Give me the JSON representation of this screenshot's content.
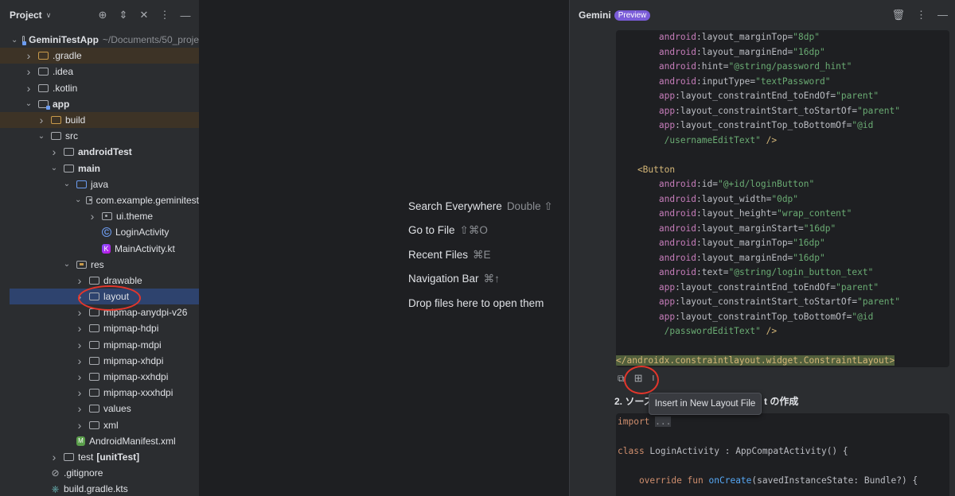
{
  "project_panel": {
    "title": "Project",
    "tree": [
      {
        "label": "GeminiTestApp",
        "suffix": "~/Documents/50_proje",
        "bold": true,
        "depth": 0,
        "arrow": "v",
        "icon": "module"
      },
      {
        "label": ".gradle",
        "depth": 1,
        "arrow": ">",
        "icon": "folder-orange",
        "highlight": "orange"
      },
      {
        "label": ".idea",
        "depth": 1,
        "arrow": ">",
        "icon": "folder"
      },
      {
        "label": ".kotlin",
        "depth": 1,
        "arrow": ">",
        "icon": "folder"
      },
      {
        "label": "app",
        "bold": true,
        "depth": 1,
        "arrow": "v",
        "icon": "module"
      },
      {
        "label": "build",
        "depth": 2,
        "arrow": ">",
        "icon": "folder-orange",
        "highlight": "orange"
      },
      {
        "label": "src",
        "depth": 2,
        "arrow": "v",
        "icon": "folder"
      },
      {
        "label": "androidTest",
        "bold": true,
        "depth": 3,
        "arrow": ">",
        "icon": "folder"
      },
      {
        "label": "main",
        "bold": true,
        "depth": 3,
        "arrow": "v",
        "icon": "folder"
      },
      {
        "label": "java",
        "depth": 4,
        "arrow": "v",
        "icon": "folder-blue"
      },
      {
        "label": "com.example.geminitest",
        "depth": 5,
        "arrow": "v",
        "icon": "package"
      },
      {
        "label": "ui.theme",
        "depth": 6,
        "arrow": ">",
        "icon": "package"
      },
      {
        "label": "LoginActivity",
        "depth": 6,
        "arrow": "",
        "icon": "class"
      },
      {
        "label": "MainActivity.kt",
        "depth": 6,
        "arrow": "",
        "icon": "kotlin"
      },
      {
        "label": "res",
        "depth": 4,
        "arrow": "v",
        "icon": "folder-res"
      },
      {
        "label": "drawable",
        "depth": 5,
        "arrow": ">",
        "icon": "folder"
      },
      {
        "label": "layout",
        "depth": 5,
        "arrow": ">",
        "icon": "folder",
        "highlight": "selected"
      },
      {
        "label": "mipmap-anydpi-v26",
        "depth": 5,
        "arrow": ">",
        "icon": "folder"
      },
      {
        "label": "mipmap-hdpi",
        "depth": 5,
        "arrow": ">",
        "icon": "folder"
      },
      {
        "label": "mipmap-mdpi",
        "depth": 5,
        "arrow": ">",
        "icon": "folder"
      },
      {
        "label": "mipmap-xhdpi",
        "depth": 5,
        "arrow": ">",
        "icon": "folder"
      },
      {
        "label": "mipmap-xxhdpi",
        "depth": 5,
        "arrow": ">",
        "icon": "folder"
      },
      {
        "label": "mipmap-xxxhdpi",
        "depth": 5,
        "arrow": ">",
        "icon": "folder"
      },
      {
        "label": "values",
        "depth": 5,
        "arrow": ">",
        "icon": "folder"
      },
      {
        "label": "xml",
        "depth": 5,
        "arrow": ">",
        "icon": "folder"
      },
      {
        "label": "AndroidManifest.xml",
        "depth": 4,
        "arrow": "",
        "icon": "xml"
      },
      {
        "label": "test",
        "suffix_bold": "[unitTest]",
        "depth": 3,
        "arrow": ">",
        "icon": "folder"
      },
      {
        "label": ".gitignore",
        "depth": 2,
        "arrow": "",
        "icon": "gitignore"
      },
      {
        "label": "build.gradle.kts",
        "depth": 2,
        "arrow": "",
        "icon": "gradle"
      }
    ]
  },
  "editor_hints": [
    {
      "label": "Search Everywhere",
      "key": "Double ⇧"
    },
    {
      "label": "Go to File",
      "key": "⇧⌘O"
    },
    {
      "label": "Recent Files",
      "key": "⌘E"
    },
    {
      "label": "Navigation Bar",
      "key": "⌘↑"
    },
    {
      "label": "Drop files here to open them",
      "key": ""
    }
  ],
  "gemini": {
    "title": "Gemini",
    "badge": "Preview",
    "code_lines": [
      [
        {
          "c": "t-ns",
          "t": "        android"
        },
        {
          "c": "t-attr",
          "t": ":layout_marginTop="
        },
        {
          "c": "t-val",
          "t": "\"8dp\""
        }
      ],
      [
        {
          "c": "t-ns",
          "t": "        android"
        },
        {
          "c": "t-attr",
          "t": ":layout_marginEnd="
        },
        {
          "c": "t-val",
          "t": "\"16dp\""
        }
      ],
      [
        {
          "c": "t-ns",
          "t": "        android"
        },
        {
          "c": "t-attr",
          "t": ":hint="
        },
        {
          "c": "t-val",
          "t": "\"@string/password_hint\""
        }
      ],
      [
        {
          "c": "t-ns",
          "t": "        android"
        },
        {
          "c": "t-attr",
          "t": ":inputType="
        },
        {
          "c": "t-val",
          "t": "\"textPassword\""
        }
      ],
      [
        {
          "c": "t-ns",
          "t": "        app"
        },
        {
          "c": "t-attr",
          "t": ":layout_constraintEnd_toEndOf="
        },
        {
          "c": "t-val",
          "t": "\"parent\""
        }
      ],
      [
        {
          "c": "t-ns",
          "t": "        app"
        },
        {
          "c": "t-attr",
          "t": ":layout_constraintStart_toStartOf="
        },
        {
          "c": "t-val",
          "t": "\"parent\""
        }
      ],
      [
        {
          "c": "t-ns",
          "t": "        app"
        },
        {
          "c": "t-attr",
          "t": ":layout_constraintTop_toBottomOf="
        },
        {
          "c": "t-val",
          "t": "\"@id"
        }
      ],
      [
        {
          "c": "t-val",
          "t": "         /usernameEditText\""
        },
        {
          "c": "t-tag",
          "t": " />"
        }
      ],
      [
        {
          "c": "t-plain",
          "t": " "
        }
      ],
      [
        {
          "c": "t-tag",
          "t": "    <Button"
        }
      ],
      [
        {
          "c": "t-ns",
          "t": "        android"
        },
        {
          "c": "t-attr",
          "t": ":id="
        },
        {
          "c": "t-val",
          "t": "\"@+id/loginButton\""
        }
      ],
      [
        {
          "c": "t-ns",
          "t": "        android"
        },
        {
          "c": "t-attr",
          "t": ":layout_width="
        },
        {
          "c": "t-val",
          "t": "\"0dp\""
        }
      ],
      [
        {
          "c": "t-ns",
          "t": "        android"
        },
        {
          "c": "t-attr",
          "t": ":layout_height="
        },
        {
          "c": "t-val",
          "t": "\"wrap_content\""
        }
      ],
      [
        {
          "c": "t-ns",
          "t": "        android"
        },
        {
          "c": "t-attr",
          "t": ":layout_marginStart="
        },
        {
          "c": "t-val",
          "t": "\"16dp\""
        }
      ],
      [
        {
          "c": "t-ns",
          "t": "        android"
        },
        {
          "c": "t-attr",
          "t": ":layout_marginTop="
        },
        {
          "c": "t-val",
          "t": "\"16dp\""
        }
      ],
      [
        {
          "c": "t-ns",
          "t": "        android"
        },
        {
          "c": "t-attr",
          "t": ":layout_marginEnd="
        },
        {
          "c": "t-val",
          "t": "\"16dp\""
        }
      ],
      [
        {
          "c": "t-ns",
          "t": "        android"
        },
        {
          "c": "t-attr",
          "t": ":text="
        },
        {
          "c": "t-val",
          "t": "\"@string/login_button_text\""
        }
      ],
      [
        {
          "c": "t-ns",
          "t": "        app"
        },
        {
          "c": "t-attr",
          "t": ":layout_constraintEnd_toEndOf="
        },
        {
          "c": "t-val",
          "t": "\"parent\""
        }
      ],
      [
        {
          "c": "t-ns",
          "t": "        app"
        },
        {
          "c": "t-attr",
          "t": ":layout_constraintStart_toStartOf="
        },
        {
          "c": "t-val",
          "t": "\"parent\""
        }
      ],
      [
        {
          "c": "t-ns",
          "t": "        app"
        },
        {
          "c": "t-attr",
          "t": ":layout_constraintTop_toBottomOf="
        },
        {
          "c": "t-val",
          "t": "\"@id"
        }
      ],
      [
        {
          "c": "t-val",
          "t": "         /passwordEditText\""
        },
        {
          "c": "t-tag",
          "t": " />"
        }
      ],
      [
        {
          "c": "t-plain",
          "t": " "
        }
      ],
      [
        {
          "c": "close-tag",
          "t": "</androidx.constraintlayout.widget.ConstraintLayout>"
        }
      ]
    ],
    "tooltip": "Insert in New Layout File",
    "section_heading_start": "2. ソース",
    "section_heading_end": "t の作成",
    "code2_lines": [
      [
        {
          "c": "kw",
          "t": "import "
        },
        {
          "c": "fold",
          "t": "..."
        }
      ],
      [
        {
          "c": "t-plain",
          "t": " "
        }
      ],
      [
        {
          "c": "kw",
          "t": "class "
        },
        {
          "c": "t-plain",
          "t": "LoginActivity : AppCompatActivity() {"
        }
      ],
      [
        {
          "c": "t-plain",
          "t": " "
        }
      ],
      [
        {
          "c": "kw",
          "t": "    override fun "
        },
        {
          "c": "fn",
          "t": "onCreate"
        },
        {
          "c": "t-plain",
          "t": "(savedInstanceState: Bundle?) {"
        }
      ]
    ]
  }
}
